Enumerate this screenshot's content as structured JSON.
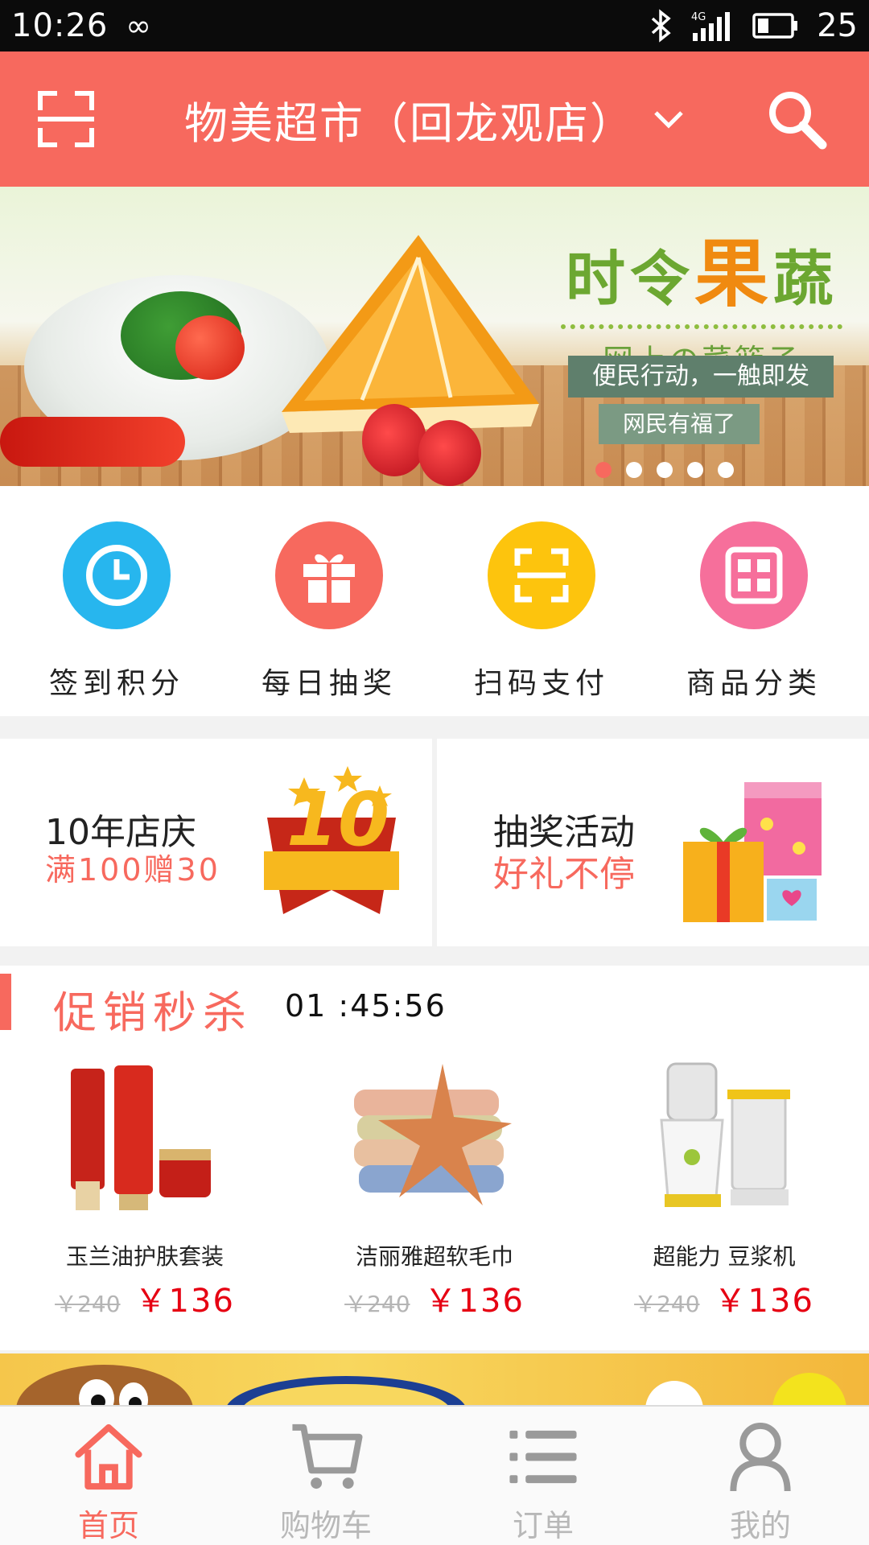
{
  "status_bar": {
    "time": "10:26",
    "infinity_glyph": "∞",
    "network": "4G",
    "battery_level": "25",
    "icons": [
      "bluetooth-icon",
      "signal-icon",
      "battery-icon"
    ]
  },
  "header": {
    "store_name": "物美超市（回龙观店）",
    "icons": [
      "scan-icon",
      "chevron-down-icon",
      "search-icon"
    ],
    "background_color": "#f7695e"
  },
  "banner": {
    "headline_left": "时令",
    "headline_accent": "果",
    "headline_right": "蔬",
    "subline": "网上の菜篮子",
    "tag_1": "便民行动，一触即发",
    "tag_2": "网民有福了",
    "slide_count": 5,
    "active_slide": 1
  },
  "quick_menu": [
    {
      "label": "签到积分",
      "icon": "clock-icon",
      "color": "#27b6ee"
    },
    {
      "label": "每日抽奖",
      "icon": "gift-icon",
      "color": "#f7695e"
    },
    {
      "label": "扫码支付",
      "icon": "scan-pay-icon",
      "color": "#fdc40d"
    },
    {
      "label": "商品分类",
      "icon": "grid-icon",
      "color": "#f66f9b"
    }
  ],
  "promos": [
    {
      "title": "10年店庆",
      "subtitle": "满100赠30",
      "image": "10-anniversary-badge"
    },
    {
      "title": "抽奖活动",
      "subtitle": "好礼不停",
      "image": "gift-boxes"
    }
  ],
  "flash_sale": {
    "title": "促销秒杀",
    "countdown": "01 :45:56",
    "products": [
      {
        "name": "玉兰油护肤套装",
        "old_price": "￥240",
        "price": "￥136",
        "image": "skincare-set"
      },
      {
        "name": "洁丽雅超软毛巾",
        "old_price": "￥240",
        "price": "￥136",
        "image": "towels-starfish"
      },
      {
        "name": "超能力 豆浆机",
        "old_price": "￥240",
        "price": "￥136",
        "image": "soymilk-maker"
      }
    ]
  },
  "tab_bar": [
    {
      "label": "首页",
      "icon": "home-icon",
      "active": true
    },
    {
      "label": "购物车",
      "icon": "cart-icon",
      "active": false
    },
    {
      "label": "订单",
      "icon": "list-icon",
      "active": false
    },
    {
      "label": "我的",
      "icon": "user-icon",
      "active": false
    }
  ]
}
